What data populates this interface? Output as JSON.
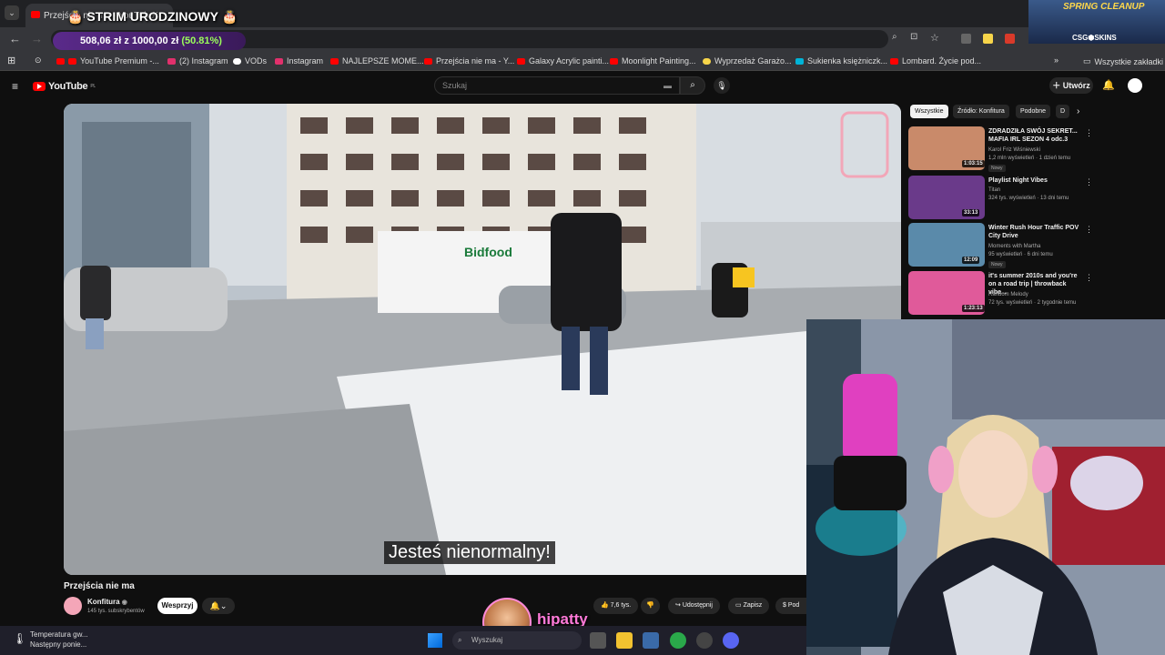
{
  "browser": {
    "tab_title": "Przejścia nie ma - YouTube",
    "url": "...v=...lkcaw&t=1s",
    "bookmarks": [
      {
        "label": "YouTube Premium -...",
        "color": "#ff0000"
      },
      {
        "label": "(2) Instagram",
        "color": "#e1306c"
      },
      {
        "label": "VODs",
        "color": "#ffffff"
      },
      {
        "label": "Instagram",
        "color": "#e1306c"
      },
      {
        "label": "NAJLEPSZE MOME...",
        "color": "#ff0000"
      },
      {
        "label": "Przejścia nie ma - Y...",
        "color": "#ff0000"
      },
      {
        "label": "Galaxy Acrylic painti...",
        "color": "#ff0000"
      },
      {
        "label": "Moonlight Painting...",
        "color": "#ff0000"
      },
      {
        "label": "Wyprzedaż Garażo...",
        "color": "#f7d54a"
      },
      {
        "label": "Sukienka księżniczk...",
        "color": "#00b4d8"
      },
      {
        "label": "Lombard. Życie pod...",
        "color": "#ff0000"
      }
    ],
    "all_bookmarks": "Wszystkie zakładki"
  },
  "overlay": {
    "stream_title": "STRIM URODZINOWY",
    "donation_current": "508,06 zł",
    "donation_sep": "z",
    "donation_goal": "1000,00 zł",
    "donation_pct": "(50.81%)",
    "sponsor_banner": "SPRING CLEANUP",
    "sponsor_name": "CSG⬢SKINS",
    "streamer_name": "hipatty"
  },
  "youtube": {
    "logo": "YouTube",
    "logo_country": "PL",
    "search_placeholder": "Szukaj",
    "create_label": "Utwórz",
    "subtitle": "Jesteś nienormalny!",
    "video_title": "Przejścia nie ma",
    "channel_name": "Konfitura",
    "channel_subs": "145 tys. subskrybentów",
    "support_label": "Wesprzyj",
    "likes": "7,6 tys.",
    "share_label": "Udostępnij",
    "save_label": "Zapisz",
    "more_label": "Pod",
    "chips": [
      "Wszystkie",
      "Źródło: Konfitura",
      "Podobne",
      "D"
    ],
    "recommendations": [
      {
        "title": "ZDRADZIŁA SWÓJ SEKRET... MAFIA IRL SEZON 4 odc.3",
        "channel": "Karol Friz Wiśniewski",
        "meta": "1,2 mln wyświetleń · 1 dzień temu",
        "badge": "Nowy",
        "duration": "1:03:15",
        "thumb": "#c98a6a"
      },
      {
        "title": "Playlist Night Vibes",
        "channel": "Titan",
        "meta": "324 tys. wyświetleń · 13 dni temu",
        "badge": "",
        "duration": "33:13",
        "thumb": "#6a3a8a"
      },
      {
        "title": "Winter Rush Hour Traffic POV City Drive",
        "channel": "Moments with Martha",
        "meta": "95 wyświetleń · 6 dni temu",
        "badge": "Nowy",
        "duration": "12:09",
        "thumb": "#5a8aaa"
      },
      {
        "title": "it's summer 2010s and you're on a road trip | throwback vibe...",
        "channel": "Random Melody",
        "meta": "72 tys. wyświetleń · 2 tygodnie temu",
        "badge": "",
        "duration": "1:23:13",
        "thumb": "#e05a9a"
      }
    ]
  },
  "taskbar": {
    "weather_title": "Temperatura gw...",
    "weather_sub": "Następny ponie...",
    "search_placeholder": "Wyszukaj"
  }
}
